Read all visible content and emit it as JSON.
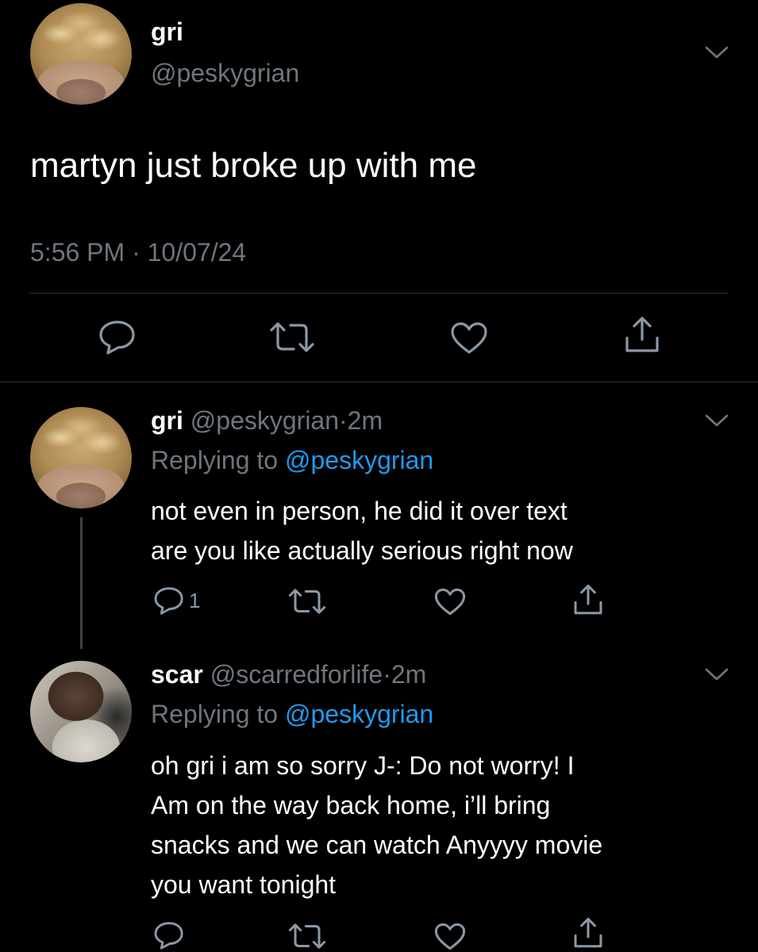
{
  "main_tweet": {
    "display_name": "gri",
    "handle": "@peskygrian",
    "text": "martyn just broke up with me",
    "time": "5:56 PM",
    "separator": "·",
    "date": "10/07/24"
  },
  "replies": [
    {
      "display_name": "gri",
      "handle": "@peskygrian",
      "dot": "·",
      "age": "2m",
      "replying_prefix": "Replying to",
      "replying_to": "@peskygrian",
      "lines": [
        "not even in person, he did it over text",
        "are you like actually serious right now"
      ],
      "reply_count": "1"
    },
    {
      "display_name": "scar",
      "handle": "@scarredforlife",
      "dot": "·",
      "age": "2m",
      "replying_prefix": "Replying to",
      "replying_to": "@peskygrian",
      "lines": [
        "oh gri i am so sorry J-: Do not worry! I",
        "Am on the way back home, i’ll bring",
        "snacks and we can watch Anyyyy movie",
        "you want tonight"
      ],
      "reply_count": ""
    }
  ],
  "colors": {
    "background": "#000000",
    "text": "#ffffff",
    "secondary": "#6e767d",
    "link": "#1d9bf0",
    "icon": "#8b98a5"
  },
  "icons": [
    "chevron-down-icon",
    "reply-icon",
    "retweet-icon",
    "like-icon",
    "share-icon"
  ]
}
